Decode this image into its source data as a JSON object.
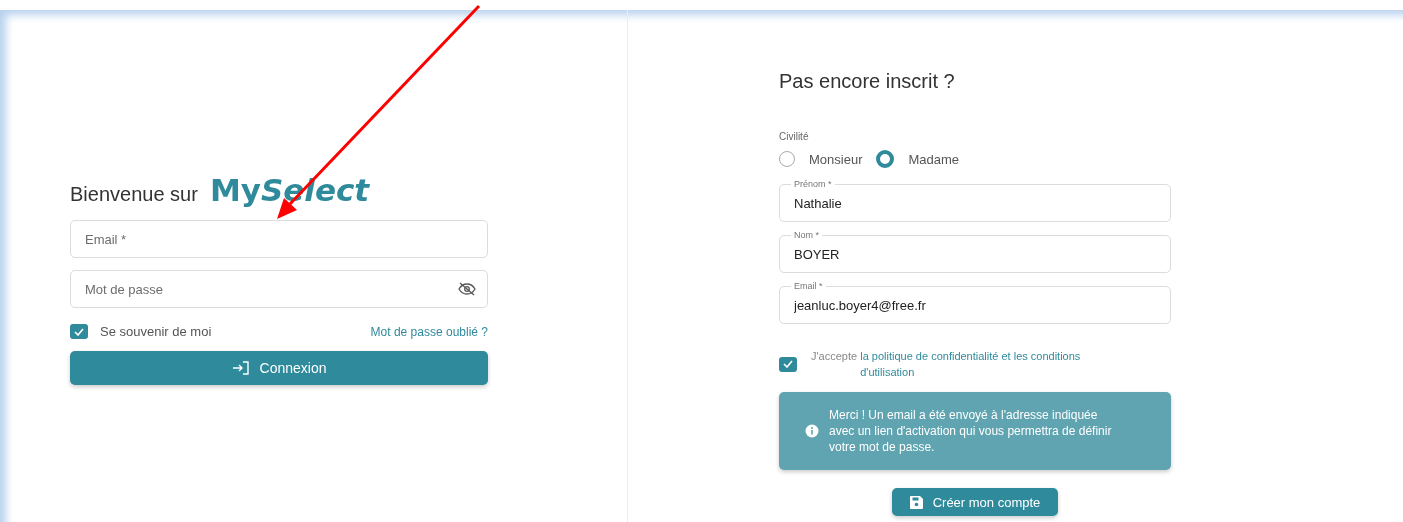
{
  "login": {
    "title": "Bienvenue sur",
    "brand_part_1": "My",
    "brand_part_2": "Select",
    "email_placeholder": "Email *",
    "password_placeholder": "Mot de passe",
    "remember": {
      "label": "Se souvenir de moi",
      "checked": true
    },
    "forgot_link": "Mot de passe oublié ?",
    "submit": "Connexion"
  },
  "signup": {
    "title": "Pas encore inscrit ?",
    "civility": {
      "label": "Civilité",
      "options": [
        {
          "label": "Monsieur",
          "selected": false
        },
        {
          "label": "Madame",
          "selected": true
        }
      ]
    },
    "fields": [
      {
        "label": "Prénom *",
        "value": "Nathalie"
      },
      {
        "label": "Nom *",
        "value": "BOYER"
      },
      {
        "label": "Email *",
        "value": "jeanluc.boyer4@free.fr"
      }
    ],
    "consent": {
      "checked": true,
      "text": "J'accepte",
      "link": "la politique de confidentialité et les conditions d'utilisation"
    },
    "alert": "Merci ! Un email a été envoyé à l'adresse indiquée avec un lien d'activation qui vous permettra de définir votre mot de passe.",
    "submit": "Créer mon compte"
  }
}
